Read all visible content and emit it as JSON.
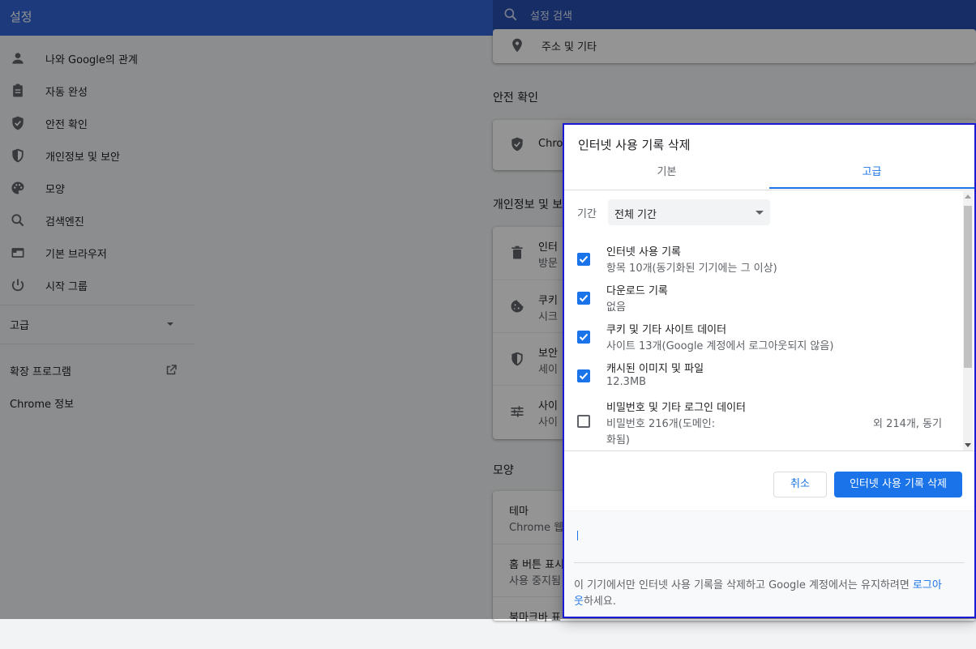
{
  "app": {
    "title": "설정",
    "search_placeholder": "설정 검색"
  },
  "sidebar": {
    "items": [
      {
        "label": "나와 Google의 관계",
        "icon": "person-icon"
      },
      {
        "label": "자동 완성",
        "icon": "clipboard-icon"
      },
      {
        "label": "안전 확인",
        "icon": "shield-check-icon"
      },
      {
        "label": "개인정보 및 보안",
        "icon": "shield-icon"
      },
      {
        "label": "모양",
        "icon": "palette-icon"
      },
      {
        "label": "검색엔진",
        "icon": "search-icon"
      },
      {
        "label": "기본 브라우저",
        "icon": "browser-icon"
      },
      {
        "label": "시작 그룹",
        "icon": "power-icon"
      }
    ],
    "advanced": "고급",
    "extensions": "확장 프로그램",
    "about": "Chrome 정보"
  },
  "main": {
    "address_row": "주소 및 기타",
    "safety_section": "안전 확인",
    "safety_row": "Chro",
    "privacy_section": "개인정보 및 보",
    "privacy_rows": [
      {
        "title": "인터",
        "sub": "방문"
      },
      {
        "title": "쿠키",
        "sub": "시크"
      },
      {
        "title": "보안",
        "sub": "세이"
      },
      {
        "title": "사이",
        "sub": "사이"
      }
    ],
    "appearance_section": "모양",
    "appearance_rows": [
      {
        "title": "테마",
        "sub": "Chrome 웹"
      },
      {
        "title": "홈 버튼 표시",
        "sub": "사용 중지됨"
      },
      {
        "title": "북마크바 표",
        "sub": ""
      }
    ]
  },
  "dialog": {
    "title": "인터넷 사용 기록 삭제",
    "tabs": {
      "basic": "기본",
      "advanced": "고급"
    },
    "period": {
      "label": "기간",
      "value": "전체 기간"
    },
    "options": [
      {
        "label": "인터넷 사용 기록",
        "desc": "항목 10개(동기화된 기기에는 그 이상)",
        "checked": true
      },
      {
        "label": "다운로드 기록",
        "desc": "없음",
        "checked": true
      },
      {
        "label": "쿠키 및 기타 사이트 데이터",
        "desc": "사이트 13개(Google 계정에서 로그아웃되지 않음)",
        "checked": true
      },
      {
        "label": "캐시된 이미지 및 파일",
        "desc": "12.3MB",
        "checked": true
      },
      {
        "label": "비밀번호 및 기타 로그인 데이터",
        "desc": "비밀번호 216개(도메인:",
        "desc_right": "외 214개, 동기",
        "desc2": "화됨)",
        "checked": false
      }
    ],
    "cancel_label": "취소",
    "delete_label": "인터넷 사용 기록 삭제",
    "footer_text": "이 기기에서만 인터넷 사용 기록을 삭제하고 Google 계정에서는 유지하려면 ",
    "footer_link_a": "로그아",
    "footer_link_b": "웃",
    "footer_tail": "하세요."
  },
  "colors": {
    "accent": "#1a73e8",
    "topbar": "#3367d6",
    "dialog_border": "#1a1ad6"
  }
}
